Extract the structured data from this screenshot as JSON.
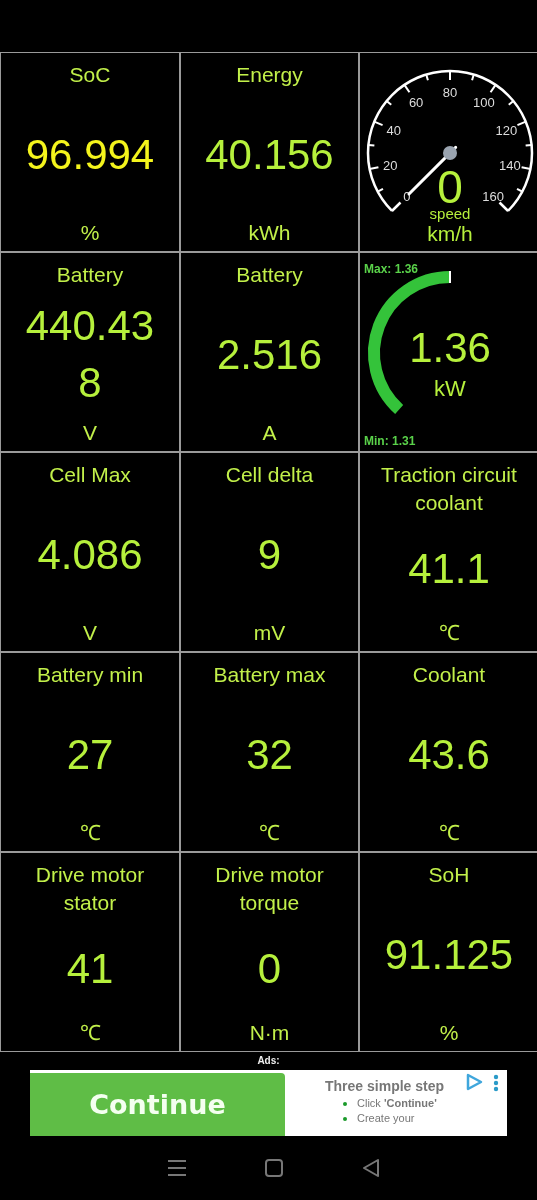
{
  "tiles": [
    {
      "kind": "value",
      "label": "SoC",
      "value": "96.994",
      "unit": "%",
      "color": "#f4f41c"
    },
    {
      "kind": "value",
      "label": "Energy",
      "value": "40.156",
      "unit": "kWh",
      "color": "#b6f03c"
    },
    {
      "kind": "speedometer",
      "value": "0",
      "label": "speed",
      "unit": "km/h",
      "ticks": [
        "0",
        "20",
        "40",
        "60",
        "80",
        "100",
        "120",
        "140",
        "160"
      ]
    },
    {
      "kind": "value",
      "label": "Battery",
      "value": "440.438",
      "unit": "V",
      "color": "#b6f03c"
    },
    {
      "kind": "value",
      "label": "Battery",
      "value": "2.516",
      "unit": "A",
      "color": "#b6f03c"
    },
    {
      "kind": "power",
      "max": "Max: 1.36",
      "min": "Min: 1.31",
      "value": "1.36",
      "unit": "kW"
    },
    {
      "kind": "value",
      "label": "Cell Max",
      "value": "4.086",
      "unit": "V",
      "color": "#b6f03c"
    },
    {
      "kind": "value",
      "label": "Cell delta",
      "value": "9",
      "unit": "mV",
      "color": "#b6f03c"
    },
    {
      "kind": "value",
      "label": "Traction circuit coolant",
      "value": "41.1",
      "unit": "℃",
      "color": "#b6f03c"
    },
    {
      "kind": "value",
      "label": "Battery min",
      "value": "27",
      "unit": "℃",
      "color": "#b6f03c"
    },
    {
      "kind": "value",
      "label": "Battery max",
      "value": "32",
      "unit": "℃",
      "color": "#b6f03c"
    },
    {
      "kind": "value",
      "label": "Coolant",
      "value": "43.6",
      "unit": "℃",
      "color": "#b6f03c"
    },
    {
      "kind": "value",
      "label": "Drive motor stator",
      "value": "41",
      "unit": "℃",
      "color": "#b6f03c"
    },
    {
      "kind": "value",
      "label": "Drive motor torque",
      "value": "0",
      "unit": "N·m",
      "color": "#b6f03c"
    },
    {
      "kind": "value",
      "label": "SoH",
      "value": "91.125",
      "unit": "%",
      "color": "#b6f03c"
    }
  ],
  "ad": {
    "label": "Ads:",
    "button": "Continue",
    "title": "Three simple step",
    "bullets": [
      "Click **'Continue'**",
      "Create your"
    ]
  }
}
